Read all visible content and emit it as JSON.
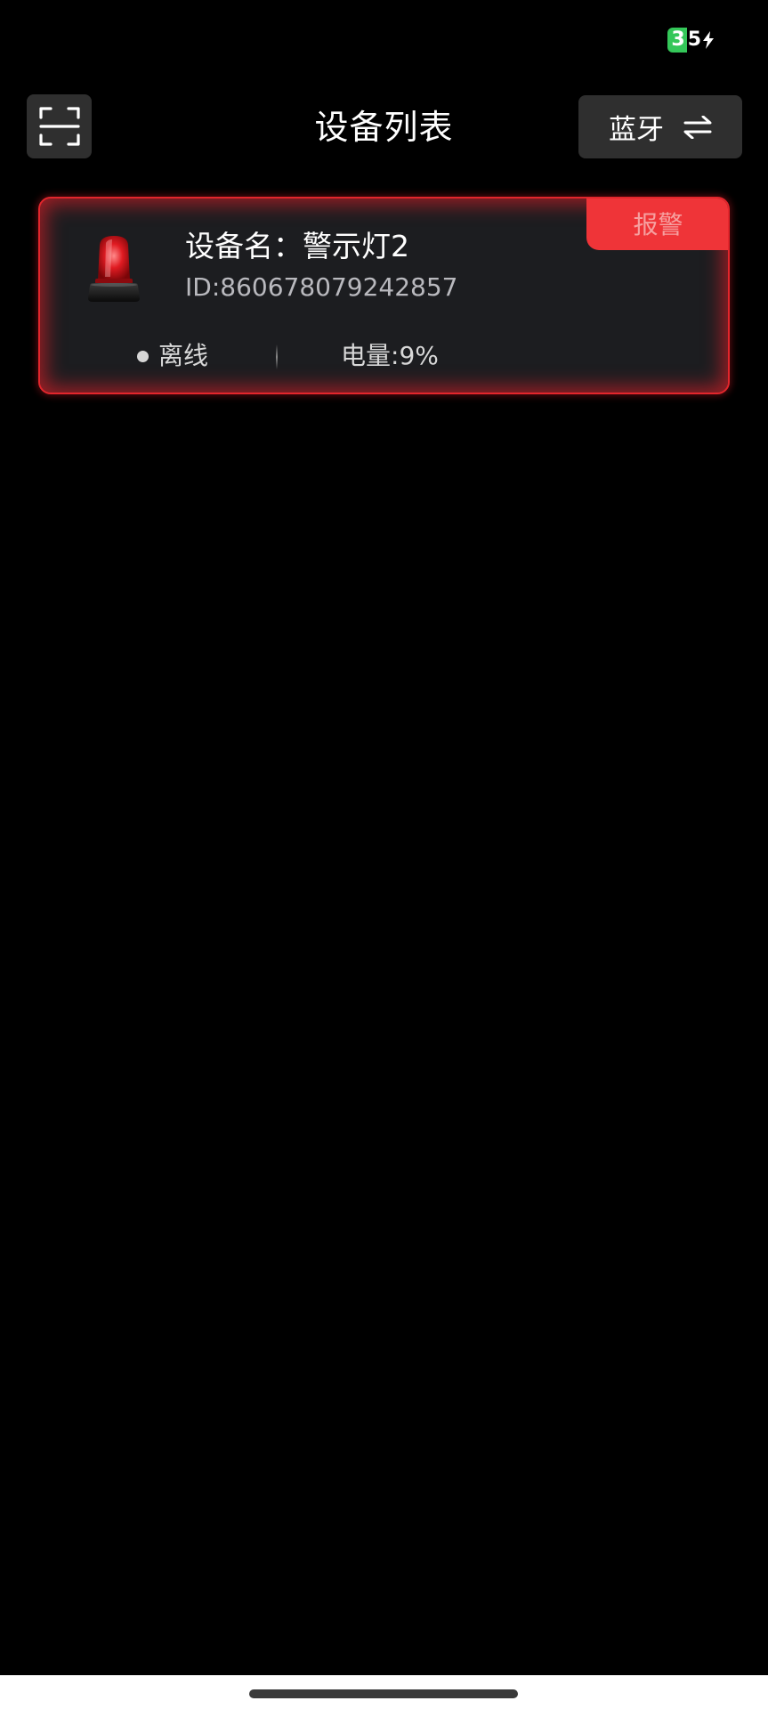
{
  "status_bar": {
    "battery_level": "35",
    "battery_color": "#34c759",
    "charging_icon": "bolt-icon"
  },
  "header": {
    "title": "设备列表",
    "scan_icon": "scan-icon",
    "bluetooth_label": "蓝牙",
    "switch_icon": "switch-arrows-icon"
  },
  "devices": [
    {
      "name_label": "设备名：",
      "name": "警示灯2",
      "id_label": "ID:",
      "id": "860678079242857",
      "status": "离线",
      "battery_label": "电量:",
      "battery_value": "9%",
      "alarm_label": "报警",
      "alarm_color": "#ef3438",
      "icon": "warning-light-icon"
    }
  ]
}
